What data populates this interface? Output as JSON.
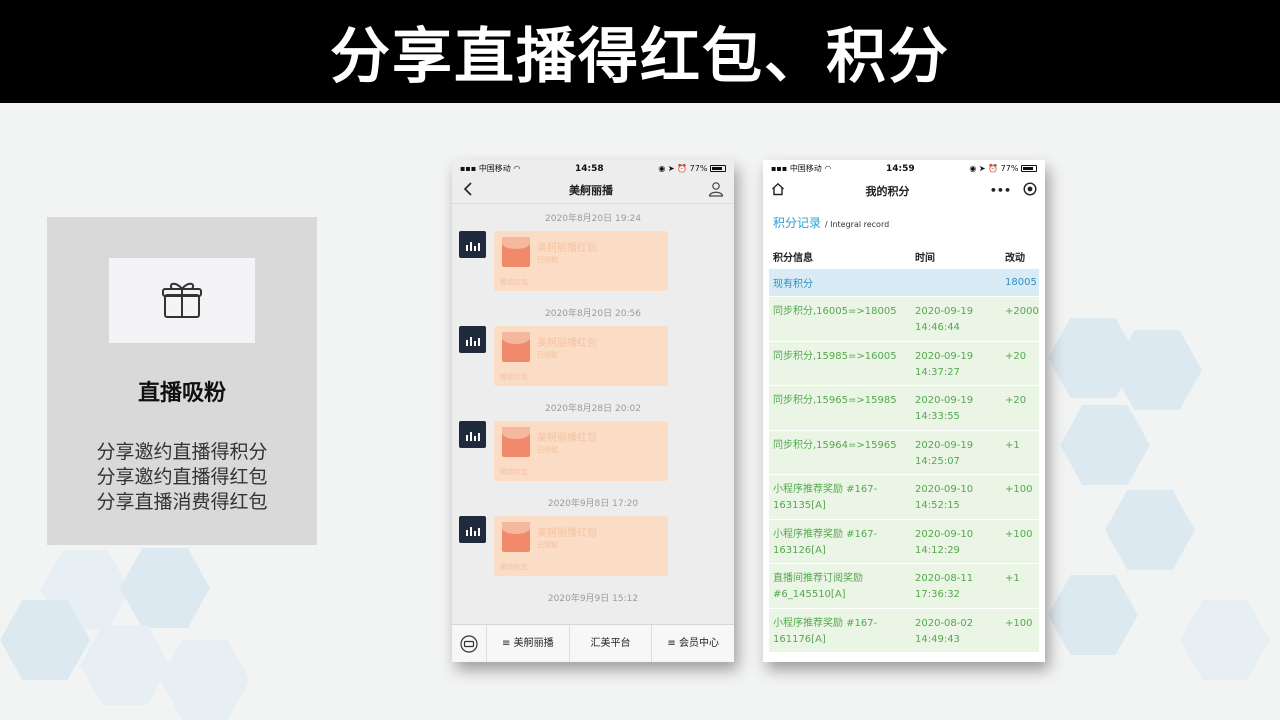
{
  "banner": {
    "title": "分享直播得红包、积分"
  },
  "card": {
    "icon": "gift-icon",
    "title": "直播吸粉",
    "lines": [
      "分享邀约直播得积分",
      "分享邀约直播得红包",
      "分享直播消费得红包"
    ]
  },
  "phone1": {
    "status": {
      "carrier": "中国移动",
      "time": "14:58",
      "battery": "77%"
    },
    "nav": {
      "back_icon": "chevron-left-icon",
      "title": "美舸丽播",
      "profile_icon": "user-icon"
    },
    "messages": [
      {
        "time": "2020年8月20日 19:24",
        "title": "美舸丽播红包",
        "status": "已领取",
        "tag": "微信红包"
      },
      {
        "time": "2020年8月20日 20:56",
        "title": "美舸丽播红包",
        "status": "已领取",
        "tag": "微信红包"
      },
      {
        "time": "2020年8月28日 20:02",
        "title": "美舸丽播红包",
        "status": "已领取",
        "tag": "微信红包"
      },
      {
        "time": "2020年9月8日 17:20",
        "title": "美舸丽播红包",
        "status": "已领取",
        "tag": "微信红包"
      }
    ],
    "last_time": "2020年9月9日 15:12",
    "tabbar": {
      "keyboard_icon": "keyboard-icon",
      "tabs": [
        "美舸丽播",
        "汇美平台",
        "会员中心"
      ]
    }
  },
  "phone2": {
    "status": {
      "carrier": "中国移动",
      "time": "14:59",
      "battery": "77%"
    },
    "nav": {
      "home_icon": "home-icon",
      "title": "我的积分",
      "more_icon": "more-icon",
      "target_icon": "target-icon"
    },
    "record_title": "积分记录",
    "record_sub": "Integral record",
    "columns": [
      "积分信息",
      "时间",
      "改动"
    ],
    "current": {
      "label": "现有积分",
      "value": "18005"
    },
    "rows": [
      {
        "info": "同步积分,16005=>18005",
        "date": "2020-09-19",
        "time": "14:46:44",
        "change": "+2000"
      },
      {
        "info": "同步积分,15985=>16005",
        "date": "2020-09-19",
        "time": "14:37:27",
        "change": "+20"
      },
      {
        "info": "同步积分,15965=>15985",
        "date": "2020-09-19",
        "time": "14:33:55",
        "change": "+20"
      },
      {
        "info": "同步积分,15964=>15965",
        "date": "2020-09-19",
        "time": "14:25:07",
        "change": "+1"
      },
      {
        "info": "小程序推荐奖励 #167-163135[A]",
        "date": "2020-09-10",
        "time": "14:52:15",
        "change": "+100"
      },
      {
        "info": "小程序推荐奖励 #167-163126[A]",
        "date": "2020-09-10",
        "time": "14:12:29",
        "change": "+100"
      },
      {
        "info": "直播间推荐订阅奖励 #6_145510[A]",
        "date": "2020-08-11",
        "time": "17:36:32",
        "change": "+1"
      },
      {
        "info": "小程序推荐奖励 #167-161176[A]",
        "date": "2020-08-02",
        "time": "14:49:43",
        "change": "+100"
      }
    ]
  }
}
